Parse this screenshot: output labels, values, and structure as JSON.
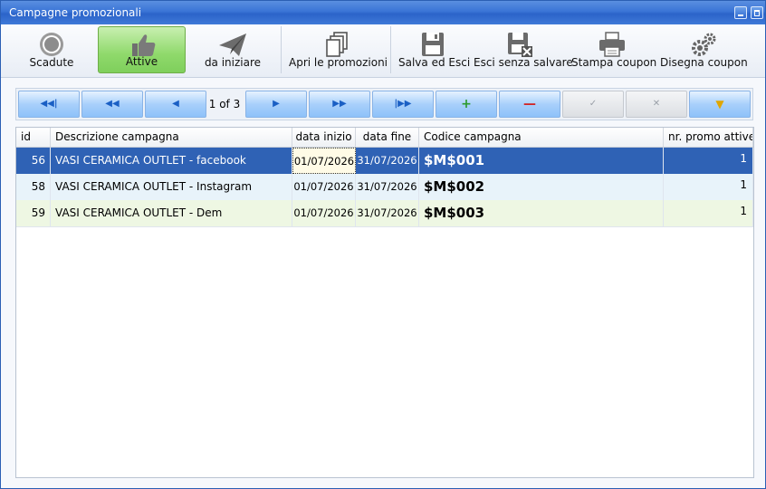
{
  "window": {
    "title": "Campagne promozionali"
  },
  "toolbar": {
    "buttons": [
      {
        "label": "Scadute",
        "icon": "circle-icon"
      },
      {
        "label": "Attive",
        "icon": "thumbs-up-icon"
      },
      {
        "label": "da iniziare",
        "icon": "paper-plane-icon"
      },
      {
        "label": "Apri le promozioni",
        "icon": "documents-icon"
      },
      {
        "label": "Salva ed Esci",
        "icon": "floppy-disk-icon"
      },
      {
        "label": "Esci senza salvare",
        "icon": "floppy-disk-x-icon"
      },
      {
        "label": "Stampa coupon",
        "icon": "printer-icon"
      },
      {
        "label": "Disegna coupon",
        "icon": "gears-icon"
      }
    ]
  },
  "navigator": {
    "page_info": "1 of 3"
  },
  "grid": {
    "columns": [
      "id",
      "Descrizione campagna",
      "data inizio",
      "data fine",
      "Codice campagna",
      "nr. promo attive"
    ],
    "rows": [
      {
        "id": "56",
        "descrizione": "VASI CERAMICA OUTLET - facebook",
        "data_inizio": "01/07/2026",
        "data_fine": "31/07/2026",
        "codice": "$M$001",
        "nr_promo": "1"
      },
      {
        "id": "58",
        "descrizione": "VASI CERAMICA OUTLET - Instagram",
        "data_inizio": "01/07/2026",
        "data_fine": "31/07/2026",
        "codice": "$M$002",
        "nr_promo": "1"
      },
      {
        "id": "59",
        "descrizione": "VASI CERAMICA OUTLET - Dem",
        "data_inizio": "01/07/2026",
        "data_fine": "31/07/2026",
        "codice": "$M$003",
        "nr_promo": "1"
      }
    ]
  },
  "colors": {
    "titlebar": "#3a74d6",
    "selected_row": "#2f62b5",
    "active_button": "#8fd96b"
  }
}
